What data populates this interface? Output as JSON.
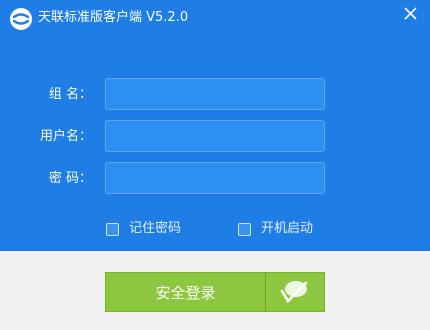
{
  "window": {
    "title": "天联标准版客户端 V5.2.0",
    "icons": {
      "logo": "tianlian-logo-icon",
      "close": "close-icon",
      "dropdown": "login-options-icon"
    }
  },
  "form": {
    "group_label": "组   名：",
    "group_value": "",
    "username_label": "用户名：",
    "username_value": "",
    "password_label": "密   码：",
    "password_value": ""
  },
  "options": {
    "remember_password": "记住密码",
    "remember_checked": false,
    "auto_start": "开机启动",
    "auto_start_checked": false
  },
  "actions": {
    "login_label": "安全登录"
  },
  "colors": {
    "primary": "#1f7de6",
    "field": "#2d8ff2",
    "button": "#8dc63f",
    "footer": "#f1f1f1"
  }
}
